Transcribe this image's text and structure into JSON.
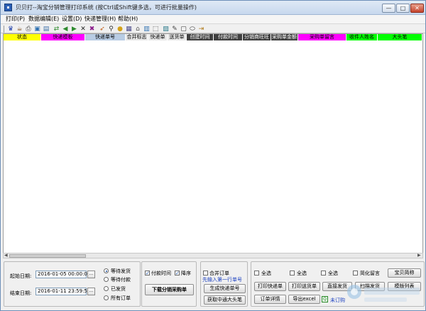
{
  "window": {
    "title": "贝贝打--淘宝分销管理打印系统 (按Ctrl或Shift键多选，可进行批量操作)",
    "minimize_glyph": "—",
    "maximize_glyph": "□",
    "close_glyph": "✕"
  },
  "menu": [
    {
      "label": "打印(P)"
    },
    {
      "label": "数据编辑(E)"
    },
    {
      "label": "设置(D)"
    },
    {
      "label": "快递管理(H)"
    },
    {
      "label": "帮助(H)"
    }
  ],
  "toolbar_icons": [
    {
      "name": "users-icon",
      "glyph": "♛",
      "color": "#1f3fa8"
    },
    {
      "name": "cup-icon",
      "glyph": "☕",
      "color": "#7a4a1a"
    },
    {
      "name": "print-icon",
      "glyph": "⎙",
      "color": "#444444"
    },
    {
      "name": "image-icon",
      "glyph": "▣",
      "color": "#2d6fb0"
    },
    {
      "name": "disk-icon",
      "glyph": "▤",
      "color": "#3a6ea8"
    },
    {
      "name": "export-icon",
      "glyph": "⇄",
      "color": "#2e8b2e"
    },
    {
      "name": "prev-icon",
      "glyph": "◀",
      "color": "#2e8b2e"
    },
    {
      "name": "next-icon",
      "glyph": "▶",
      "color": "#2e8b2e"
    },
    {
      "name": "delete-icon",
      "glyph": "✕",
      "color": "#222222"
    },
    {
      "name": "x-icon",
      "glyph": "✖",
      "color": "#8a1a8a"
    },
    {
      "name": "rocket-icon",
      "glyph": "➶",
      "color": "#c05a10"
    },
    {
      "name": "binoculars-icon",
      "glyph": "⚲",
      "color": "#333333"
    },
    {
      "name": "lock-icon",
      "glyph": "●",
      "color": "#d4a21a"
    },
    {
      "name": "grid-icon",
      "glyph": "▦",
      "color": "#4a4a8a"
    },
    {
      "name": "bank-icon",
      "glyph": "⌂",
      "color": "#555555"
    },
    {
      "name": "table-icon",
      "glyph": "▥",
      "color": "#2d6fb0"
    },
    {
      "name": "select-icon",
      "glyph": "⬚",
      "color": "#333333"
    },
    {
      "name": "picture-icon",
      "glyph": "▨",
      "color": "#2a7a8a"
    },
    {
      "name": "brush-icon",
      "glyph": "✎",
      "color": "#444444"
    },
    {
      "name": "frame-icon",
      "glyph": "▢",
      "color": "#333333"
    },
    {
      "name": "ellipse-icon",
      "glyph": "⬭",
      "color": "#333333"
    },
    {
      "name": "exit-icon",
      "glyph": "⇥",
      "color": "#b07a1a"
    }
  ],
  "grid": {
    "columns": [
      {
        "label": "状态",
        "bg": "#ffff00",
        "fg": "#000000"
      },
      {
        "label": "快递模板",
        "bg": "#ff00ff",
        "fg": "#000000"
      },
      {
        "label": "快递单号",
        "bg": "#b8cce4",
        "fg": "#000000"
      },
      {
        "label": "合并标志",
        "bg": "#e8e8e8",
        "fg": "#000000"
      },
      {
        "label": "快递单",
        "bg": "#e8e8e8",
        "fg": "#000000"
      },
      {
        "label": "送货单",
        "bg": "#e8e8e8",
        "fg": "#000000"
      },
      {
        "label": "创建时间",
        "bg": "#404040",
        "fg": "#ffffff"
      },
      {
        "label": "付款时间",
        "bg": "#404040",
        "fg": "#ffffff"
      },
      {
        "label": "分销商旺旺",
        "bg": "#404040",
        "fg": "#ffffff"
      },
      {
        "label": "采购单金额",
        "bg": "#404040",
        "fg": "#ffffff"
      },
      {
        "label": "采购单留言",
        "bg": "#ff00ff",
        "fg": "#000000"
      },
      {
        "label": "收件人姓名",
        "bg": "#00ff00",
        "fg": "#000000"
      },
      {
        "label": "大头笔",
        "bg": "#00ff00",
        "fg": "#000000"
      }
    ]
  },
  "filters": {
    "start_label": "起始日期:",
    "start_value": "2016-01-05 00:00:00",
    "end_label": "结束日期:",
    "end_value": "2016-01-11 23:59:59",
    "dot_button": "...",
    "status_options": [
      "等待发货",
      "等待付款",
      "已发货",
      "所有订单"
    ],
    "status_selected": 0,
    "pay_time_label": "付款时间",
    "pay_time_checked": true,
    "desc_label": "降序",
    "desc_checked": true,
    "download_button": "下载分销采购单"
  },
  "merge_panel": {
    "merge_label": "合并订单",
    "hint": "先输入第一行单号",
    "generate_button": "生成快递单号",
    "fetch_button": "获取中通大头笔"
  },
  "actions": {
    "select_all_1": "全选",
    "select_all_2": "全选",
    "select_all_3": "全选",
    "simplify_label": "简化留言",
    "print_express": "打印快递单",
    "print_delivery": "打印送货单",
    "ship_direct": "直接发货",
    "scan_ship": "扫描发货",
    "order_detail": "订单详情",
    "export_excel": "导出excel",
    "unsubscribed": "未订购",
    "product_alias": "宝贝简称",
    "template_list": "模版列表"
  }
}
